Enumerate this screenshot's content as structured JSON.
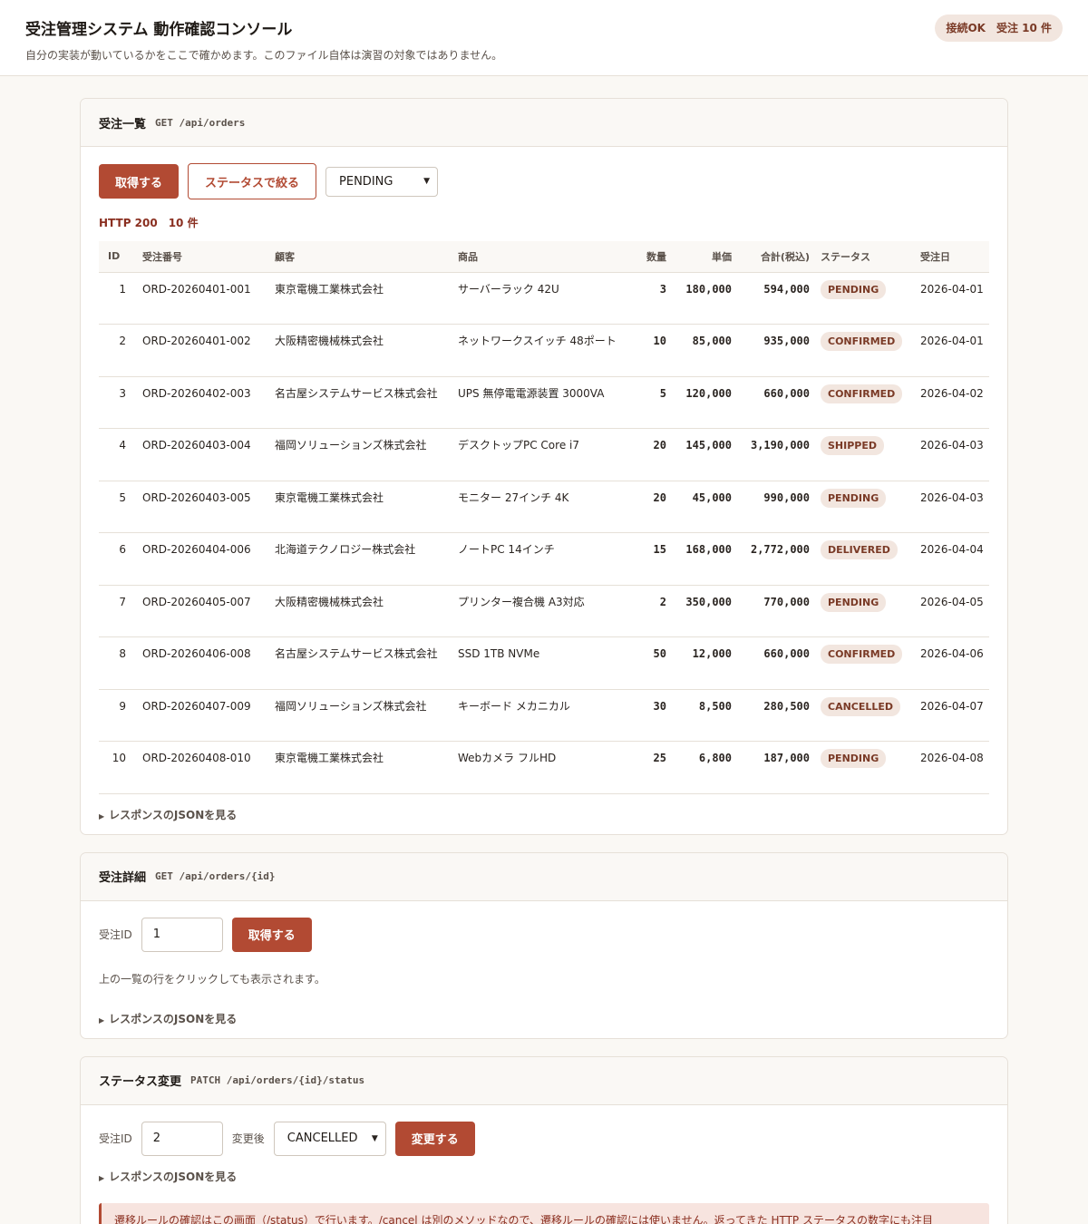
{
  "header": {
    "title": "受注管理システム 動作確認コンソール",
    "subtitle": "自分の実装が動いているかをここで確かめます。このファイル自体は演習の対象ではありません。",
    "connection_status": "接続OK　受注 10 件"
  },
  "list_section": {
    "title": "受注一覧",
    "endpoint": "GET /api/orders",
    "fetch_label": "取得する",
    "filter_label": "ステータスで絞る",
    "filter_value": "PENDING",
    "http_status": "HTTP 200　10 件",
    "columns": [
      "ID",
      "受注番号",
      "顧客",
      "商品",
      "数量",
      "単価",
      "合計(税込)",
      "ステータス",
      "受注日"
    ],
    "rows": [
      {
        "id": "1",
        "order_no": "ORD-20260401-001",
        "customer": "東京電機工業株式会社",
        "product": "サーバーラック 42U",
        "qty": "3",
        "unit_price": "180,000",
        "total": "594,000",
        "status": "PENDING",
        "date": "2026-04-01"
      },
      {
        "id": "2",
        "order_no": "ORD-20260401-002",
        "customer": "大阪精密機械株式会社",
        "product": "ネットワークスイッチ 48ポート",
        "qty": "10",
        "unit_price": "85,000",
        "total": "935,000",
        "status": "CONFIRMED",
        "date": "2026-04-01"
      },
      {
        "id": "3",
        "order_no": "ORD-20260402-003",
        "customer": "名古屋システムサービス株式会社",
        "product": "UPS 無停電電源装置 3000VA",
        "qty": "5",
        "unit_price": "120,000",
        "total": "660,000",
        "status": "CONFIRMED",
        "date": "2026-04-02"
      },
      {
        "id": "4",
        "order_no": "ORD-20260403-004",
        "customer": "福岡ソリューションズ株式会社",
        "product": "デスクトップPC Core i7",
        "qty": "20",
        "unit_price": "145,000",
        "total": "3,190,000",
        "status": "SHIPPED",
        "date": "2026-04-03"
      },
      {
        "id": "5",
        "order_no": "ORD-20260403-005",
        "customer": "東京電機工業株式会社",
        "product": "モニター 27インチ 4K",
        "qty": "20",
        "unit_price": "45,000",
        "total": "990,000",
        "status": "PENDING",
        "date": "2026-04-03"
      },
      {
        "id": "6",
        "order_no": "ORD-20260404-006",
        "customer": "北海道テクノロジー株式会社",
        "product": "ノートPC 14インチ",
        "qty": "15",
        "unit_price": "168,000",
        "total": "2,772,000",
        "status": "DELIVERED",
        "date": "2026-04-04"
      },
      {
        "id": "7",
        "order_no": "ORD-20260405-007",
        "customer": "大阪精密機械株式会社",
        "product": "プリンター複合機 A3対応",
        "qty": "2",
        "unit_price": "350,000",
        "total": "770,000",
        "status": "PENDING",
        "date": "2026-04-05"
      },
      {
        "id": "8",
        "order_no": "ORD-20260406-008",
        "customer": "名古屋システムサービス株式会社",
        "product": "SSD 1TB NVMe",
        "qty": "50",
        "unit_price": "12,000",
        "total": "660,000",
        "status": "CONFIRMED",
        "date": "2026-04-06"
      },
      {
        "id": "9",
        "order_no": "ORD-20260407-009",
        "customer": "福岡ソリューションズ株式会社",
        "product": "キーボード メカニカル",
        "qty": "30",
        "unit_price": "8,500",
        "total": "280,500",
        "status": "CANCELLED",
        "date": "2026-04-07"
      },
      {
        "id": "10",
        "order_no": "ORD-20260408-010",
        "customer": "東京電機工業株式会社",
        "product": "Webカメラ フルHD",
        "qty": "25",
        "unit_price": "6,800",
        "total": "187,000",
        "status": "PENDING",
        "date": "2026-04-08"
      }
    ],
    "json_toggle": "レスポンスのJSONを見る"
  },
  "detail_section": {
    "title": "受注詳細",
    "endpoint": "GET /api/orders/{id}",
    "id_label": "受注ID",
    "id_value": "1",
    "fetch_label": "取得する",
    "hint": "上の一覧の行をクリックしても表示されます。",
    "json_toggle": "レスポンスのJSONを見る"
  },
  "status_section": {
    "title": "ステータス変更",
    "endpoint": "PATCH /api/orders/{id}/status",
    "id_label": "受注ID",
    "id_value": "2",
    "after_label": "変更後",
    "after_value": "CANCELLED",
    "submit_label": "変更する",
    "json_toggle": "レスポンスのJSONを見る",
    "note": "遷移ルールの確認はこの画面（/status）で行います。/cancel は別のメソッドなので、遷移ルールの確認には使いません。返ってきた HTTP ステータスの数字にも注目"
  },
  "icons": {
    "select_chevron": "chevron-down-icon",
    "disclosure": "disclosure-triangle-icon"
  },
  "colors": {
    "accent": "#b24a33",
    "badge_bg": "#f2e6df",
    "badge_text": "#7a3a26",
    "http_status": "#8a2f20"
  }
}
